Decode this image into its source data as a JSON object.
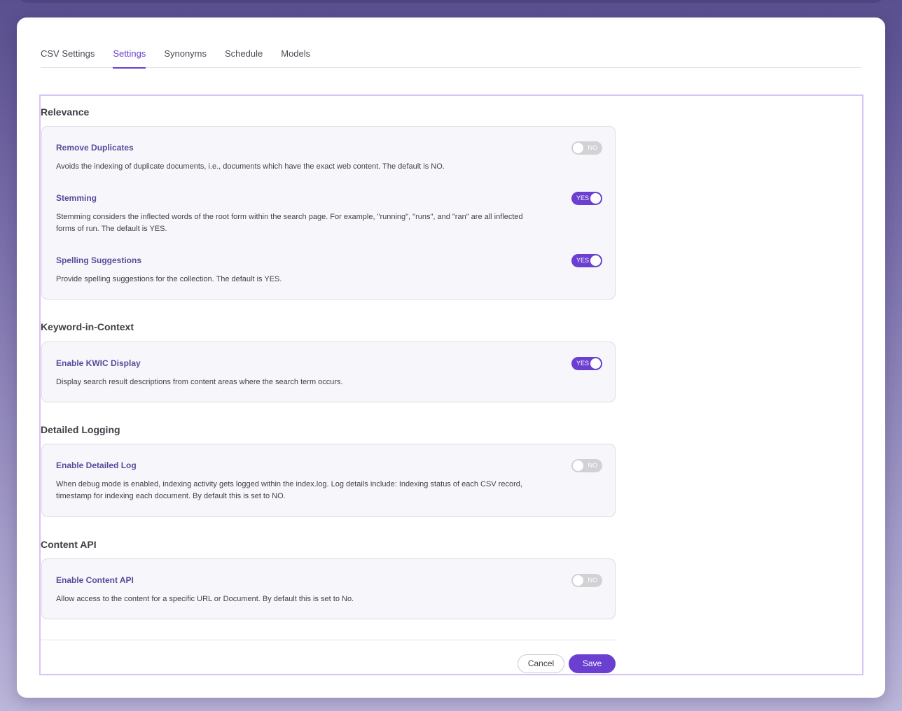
{
  "tabs": [
    {
      "label": "CSV Settings",
      "active": false
    },
    {
      "label": "Settings",
      "active": true
    },
    {
      "label": "Synonyms",
      "active": false
    },
    {
      "label": "Schedule",
      "active": false
    },
    {
      "label": "Models",
      "active": false
    }
  ],
  "sections": {
    "relevance": {
      "title": "Relevance",
      "settings": {
        "remove_duplicates": {
          "title": "Remove Duplicates",
          "description": "Avoids the indexing of duplicate documents, i.e., documents which have the exact web content. The default is NO.",
          "state": "NO"
        },
        "stemming": {
          "title": "Stemming",
          "description": "Stemming considers the inflected words of the root form within the search page. For example, \"running\", \"runs\", and \"ran\" are all inflected forms of run. The default is YES.",
          "state": "YES"
        },
        "spelling_suggestions": {
          "title": "Spelling Suggestions",
          "description": "Provide spelling suggestions for the collection. The default is YES.",
          "state": "YES"
        }
      }
    },
    "kwic": {
      "title": "Keyword-in-Context",
      "settings": {
        "enable_kwic": {
          "title": "Enable KWIC Display",
          "description": "Display search result descriptions from content areas where the search term occurs.",
          "state": "YES"
        }
      }
    },
    "logging": {
      "title": "Detailed Logging",
      "settings": {
        "enable_log": {
          "title": "Enable Detailed Log",
          "description": "When debug mode is enabled, indexing activity gets logged within the index.log. Log details include: Indexing status of each CSV record, timestamp for indexing each document. By default this is set to NO.",
          "state": "NO"
        }
      }
    },
    "content_api": {
      "title": "Content API",
      "settings": {
        "enable_api": {
          "title": "Enable Content API",
          "description": "Allow access to the content for a specific URL or Document. By default this is set to No.",
          "state": "NO"
        }
      }
    }
  },
  "buttons": {
    "cancel": "Cancel",
    "save": "Save"
  },
  "colors": {
    "accent": "#6b3fd0",
    "toggle_off": "#d2d2d6",
    "setting_title": "#5a4a9c"
  }
}
